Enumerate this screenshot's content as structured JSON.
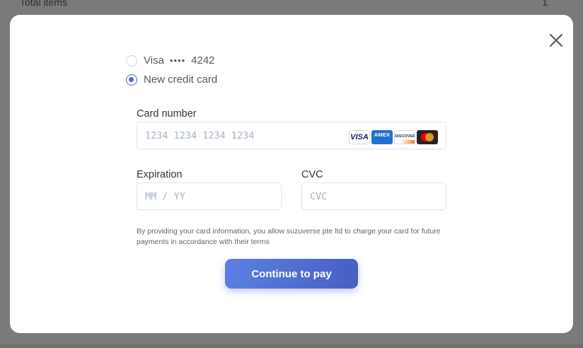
{
  "background": {
    "total_items_label": "Total items",
    "total_items_value": "1"
  },
  "payment_methods": [
    {
      "brand": "Visa",
      "masked": "••••",
      "last4": "4242",
      "selected": false
    },
    {
      "label": "New credit card",
      "selected": true
    }
  ],
  "form": {
    "card_number_label": "Card number",
    "card_number_placeholder": "1234 1234 1234 1234",
    "expiration_label": "Expiration",
    "expiration_placeholder": "MM / YY",
    "cvc_label": "CVC",
    "cvc_placeholder": "CVC"
  },
  "card_brands": [
    {
      "name": "visa",
      "text": "VISA"
    },
    {
      "name": "amex",
      "text": "AMEX"
    },
    {
      "name": "discover",
      "text": "DISCOVER"
    },
    {
      "name": "mastercard",
      "text": ""
    }
  ],
  "disclaimer": "By providing your card information, you allow suzuverse pte ltd to charge your card for future payments in accordance with their terms",
  "submit_label": "Continue to pay",
  "colors": {
    "accent": "#5668c9",
    "button_start": "#5b7fe0",
    "button_end": "#4760c2",
    "backdrop": "#7a7a7a"
  },
  "icons": {
    "close": "close-icon"
  }
}
